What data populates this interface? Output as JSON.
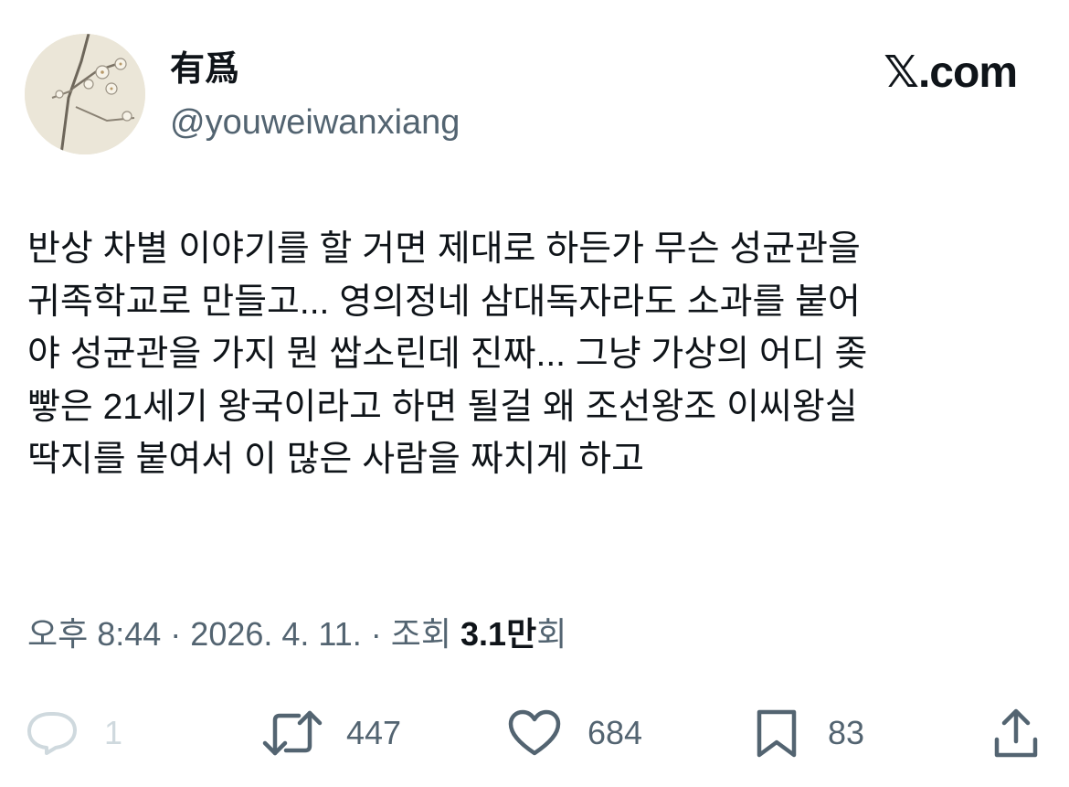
{
  "user": {
    "display_name": "有爲",
    "handle": "@youweiwanxiang",
    "avatar_icon": "plum-blossom-painting"
  },
  "brand": {
    "label": "𝕏.com"
  },
  "tweet": {
    "text": "반상 차별 이야기를 할 거면 제대로 하든가 무슨 성균관을\n귀족학교로 만들고... 영의정네 삼대독자라도 소과를 붙어\n야 성균관을 가지 뭔 쌉소린데 진짜... 그냥 가상의 어디 좆\n빻은 21세기 왕국이라고 하면 될걸 왜 조선왕조 이씨왕실\n딱지를 붙여서 이 많은 사람을 짜치게 하고"
  },
  "meta": {
    "time_date": "오후 8:44 · 2026. 4. 11. · 조회 ",
    "views_count": "3.1만",
    "views_suffix": "회"
  },
  "actions": {
    "reply_count": "1",
    "retweet_count": "447",
    "like_count": "684",
    "bookmark_count": "83"
  },
  "colors": {
    "text": "#0f1419",
    "secondary": "#536471",
    "muted": "#cfd9de"
  }
}
